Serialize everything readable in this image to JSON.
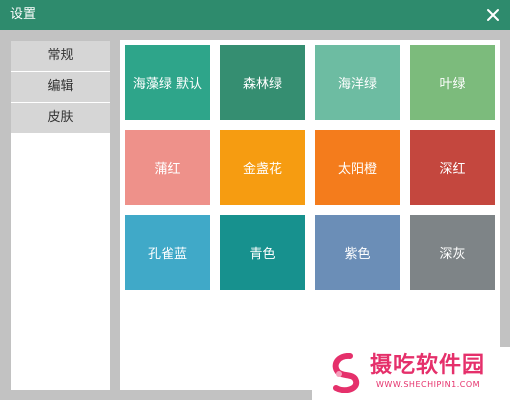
{
  "window": {
    "title": "设置",
    "close_icon": "close-icon"
  },
  "sidebar": {
    "items": [
      {
        "label": "常规"
      },
      {
        "label": "编辑"
      },
      {
        "label": "皮肤"
      }
    ]
  },
  "skins": [
    {
      "label": "海藻绿 默认",
      "color": "#2ea58a"
    },
    {
      "label": "森林绿",
      "color": "#358e71"
    },
    {
      "label": "海洋绿",
      "color": "#6dbca2"
    },
    {
      "label": "叶绿",
      "color": "#7cbb7c"
    },
    {
      "label": "蒲红",
      "color": "#ee918a"
    },
    {
      "label": "金盏花",
      "color": "#f69c11"
    },
    {
      "label": "太阳橙",
      "color": "#f47c1c"
    },
    {
      "label": "深红",
      "color": "#c4473e"
    },
    {
      "label": "孔雀蓝",
      "color": "#40a9c8"
    },
    {
      "label": "青色",
      "color": "#17918e"
    },
    {
      "label": "紫色",
      "color": "#6b8eb7"
    },
    {
      "label": "深灰",
      "color": "#7e8487"
    }
  ],
  "watermark": {
    "text": "摄吃软件园",
    "url": "WWW.SHECHIPIN1.COM",
    "color": "#e5306b"
  }
}
